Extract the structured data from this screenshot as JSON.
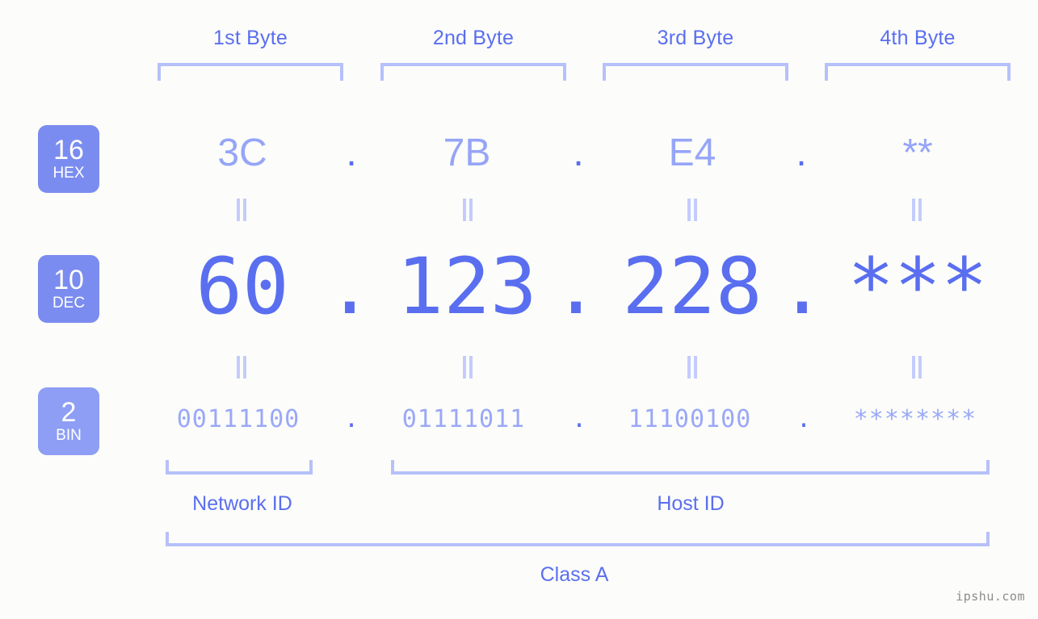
{
  "background_color": "#fcfdfa",
  "accent_color": "#5a6ef0",
  "accent_light": "#96a5f7",
  "bracket_color": "#b6c0fb",
  "badge_color": "#7b8cf0",
  "byte_headers": [
    {
      "label": "1st Byte"
    },
    {
      "label": "2nd Byte"
    },
    {
      "label": "3rd Byte"
    },
    {
      "label": "4th Byte"
    }
  ],
  "rows": [
    {
      "badge_number": "16",
      "badge_name": "HEX",
      "values": [
        "3C",
        "7B",
        "E4",
        "**"
      ],
      "separator": "."
    },
    {
      "badge_number": "10",
      "badge_name": "DEC",
      "values": [
        "60",
        "123",
        "228",
        "***"
      ],
      "separator": "."
    },
    {
      "badge_number": "2",
      "badge_name": "BIN",
      "values": [
        "00111100",
        "01111011",
        "11100100",
        "********"
      ],
      "separator": "."
    }
  ],
  "equals_mark": "=",
  "segments": [
    {
      "label": "Network ID"
    },
    {
      "label": "Host ID"
    }
  ],
  "class_label": "Class A",
  "watermark": "ipshu.com"
}
